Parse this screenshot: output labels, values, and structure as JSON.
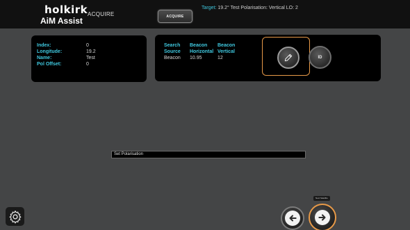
{
  "header": {
    "brand": "holkirk",
    "product": "AiM Assist",
    "mode_label": "ACQUIRE",
    "acquire_button": "ACQUIRE",
    "target_key": "Target:",
    "target_value": "19.2° Test Polarisation: Vertical LO: 2"
  },
  "info": {
    "rows": [
      {
        "key": "Index:",
        "value": "0"
      },
      {
        "key": "Longitude:",
        "value": "19.2"
      },
      {
        "key": "Name:",
        "value": "Test"
      },
      {
        "key": "Pol Offset:",
        "value": "0"
      }
    ]
  },
  "beacon": {
    "col1": [
      "Search",
      "Source",
      "Beacon"
    ],
    "col2": [
      "Beacon",
      "Horizontal",
      "10.95"
    ],
    "col3": [
      "Beacon",
      "Vertical",
      "12"
    ]
  },
  "actions": {
    "edit_icon": "pencil-icon",
    "id_button": "ID"
  },
  "status": {
    "text": "Set Polarisation"
  },
  "footer": {
    "settings_icon": "gear-icon",
    "prev_icon": "arrow-left-icon",
    "next_icon": "arrow-right-icon",
    "next_tooltip": "Next Satellite"
  },
  "colors": {
    "accent": "#3fc9e0",
    "highlight": "#e89a48",
    "background": "#444546",
    "topbar": "#111111"
  }
}
